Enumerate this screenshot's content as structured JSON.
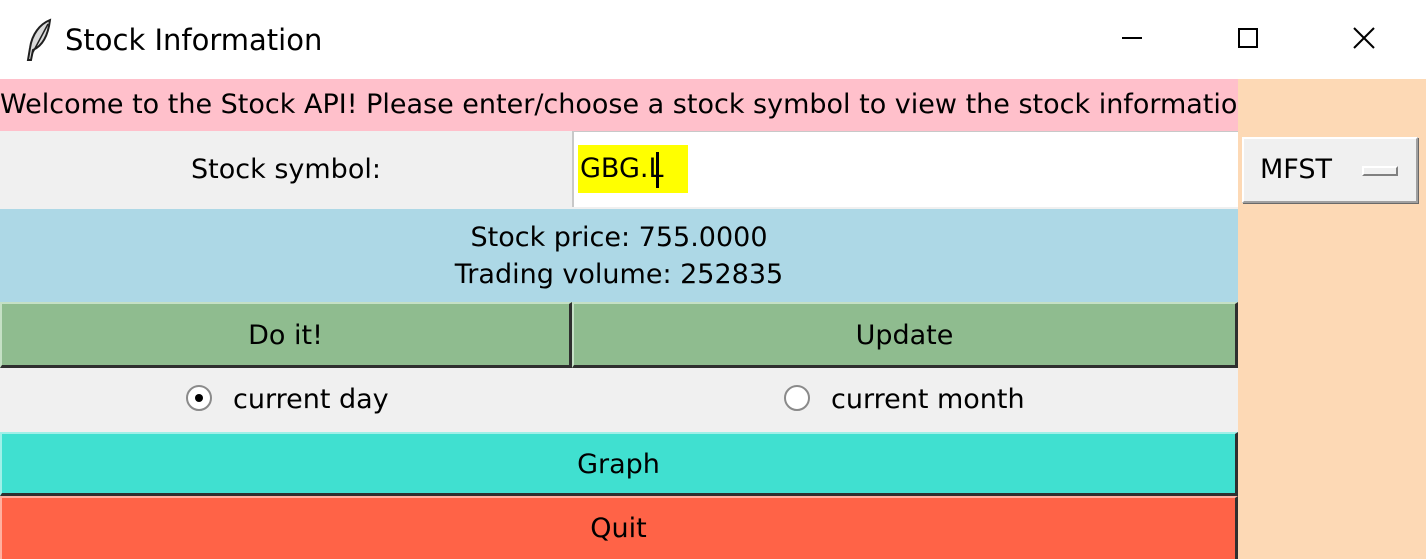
{
  "window": {
    "title": "Stock Information",
    "icon": "feather-icon",
    "controls": [
      "minimize-icon",
      "maximize-icon",
      "close-icon"
    ]
  },
  "welcome_text": "Welcome to the Stock API! Please enter/choose a stock symbol to view the stock information",
  "symbol": {
    "label": "Stock symbol:",
    "value": "GBG.L"
  },
  "dropdown": {
    "selected": "MFST"
  },
  "info": {
    "price": "Stock price: 755.0000",
    "volume": "Trading volume: 252835"
  },
  "buttons": {
    "do_it": "Do it!",
    "update": "Update",
    "graph": "Graph",
    "quit": "Quit"
  },
  "radios": {
    "day_label": "current day",
    "month_label": "current month",
    "selected": "current day"
  },
  "colors": {
    "window_bg": "#fdd9b5",
    "welcome_bg": "#ffc0cb",
    "info_bg": "#add8e6",
    "green_button": "#8fbc8f",
    "graph_button": "#40e0d0",
    "quit_button": "#ff6347",
    "input_highlight": "#ffff00"
  }
}
